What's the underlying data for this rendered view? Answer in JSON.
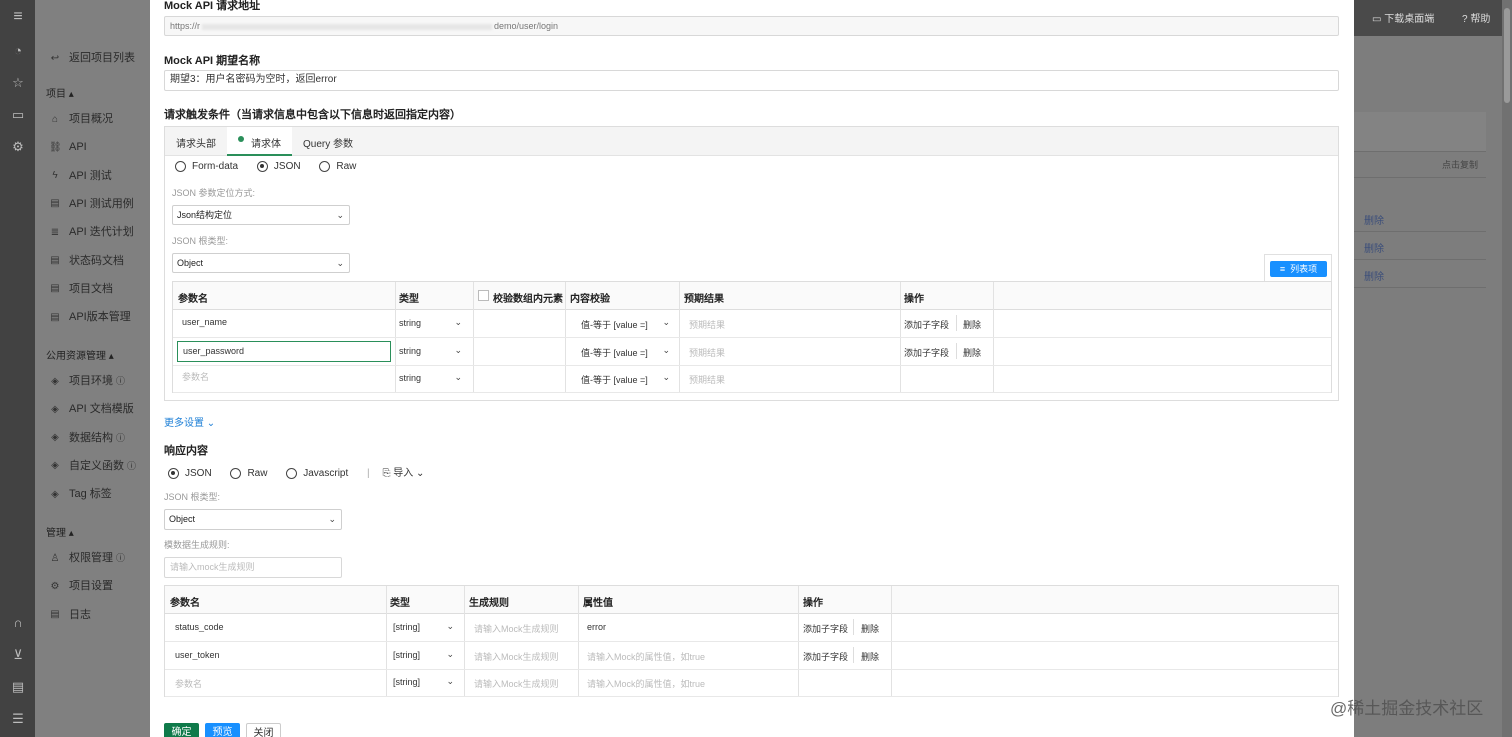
{
  "topbar": {
    "download": "下载桌面端",
    "help": "帮助"
  },
  "sidebar": {
    "back": "返回项目列表",
    "section_project": "项目 ▴",
    "items_project": [
      {
        "label": "项目概况",
        "icon": "house-icon"
      },
      {
        "label": "API",
        "icon": "link-icon"
      },
      {
        "label": "API 测试",
        "icon": "flash-icon"
      },
      {
        "label": "API 测试用例",
        "icon": "doc-icon"
      },
      {
        "label": "API 迭代计划",
        "icon": "list-icon"
      },
      {
        "label": "状态码文档",
        "icon": "doc-icon"
      },
      {
        "label": "项目文档",
        "icon": "doc-icon"
      },
      {
        "label": "API版本管理",
        "icon": "doc-icon"
      }
    ],
    "section_public": "公用资源管理 ▴",
    "items_public": [
      {
        "label": "项目环境",
        "icon": "cube-icon",
        "info": "ⓘ"
      },
      {
        "label": "API 文档模版",
        "icon": "cube-icon",
        "info": ""
      },
      {
        "label": "数据结构",
        "icon": "cube-icon",
        "info": "ⓘ"
      },
      {
        "label": "自定义函数",
        "icon": "cube-icon",
        "info": "ⓘ"
      },
      {
        "label": "Tag 标签",
        "icon": "cube-icon",
        "info": ""
      }
    ],
    "section_manage": "管理 ▴",
    "items_manage": [
      {
        "label": "权限管理",
        "icon": "user-icon",
        "info": "ⓘ"
      },
      {
        "label": "项目设置",
        "icon": "gear-icon",
        "info": ""
      },
      {
        "label": "日志",
        "icon": "doc-icon",
        "info": ""
      }
    ]
  },
  "background": {
    "copy": "点击复制",
    "delete": "删除"
  },
  "form": {
    "api_url_label": "Mock API 请求地址",
    "api_url_start": "https://r",
    "api_url_end": "demo/user/login",
    "name_label": "Mock API 期望名称",
    "name_value": "期望3：用户名密码为空时，返回error",
    "cond_label": "请求触发条件（当请求信息中包含以下信息时返回指定内容）",
    "tabs": [
      "请求头部",
      "请求体",
      "Query 参数"
    ],
    "body_types": [
      "Form-data",
      "JSON",
      "Raw"
    ],
    "json_locate_label": "JSON 参数定位方式:",
    "json_locate_value": "Json结构定位",
    "json_root_label": "JSON 根类型:",
    "json_root_value": "Object",
    "list_button": "列表项",
    "req_table": {
      "headers": {
        "name": "参数名",
        "type": "类型",
        "check_array": "校验数组内元素",
        "content": "内容校验",
        "expected": "预期结果",
        "ops": "操作"
      },
      "rows": [
        {
          "name": "user_name",
          "type": "string",
          "content": "值-等于 [value =]",
          "expected": "预期结果",
          "add": "添加子字段",
          "del": "删除"
        },
        {
          "name": "user_password",
          "type": "string",
          "content": "值-等于 [value =]",
          "expected": "预期结果",
          "add": "添加子字段",
          "del": "删除"
        },
        {
          "name": "参数名",
          "type": "string",
          "content": "值-等于 [value =]",
          "expected": "预期结果",
          "add": "",
          "del": ""
        }
      ]
    },
    "more_settings": "更多设置",
    "resp_label": "响应内容",
    "resp_types": [
      "JSON",
      "Raw",
      "Javascript"
    ],
    "import": "导入",
    "resp_root_label": "JSON 根类型:",
    "resp_root_value": "Object",
    "mock_rule_label": "模数据生成规则:",
    "mock_rule_placeholder": "请输入mock生成规则",
    "resp_table": {
      "headers": {
        "name": "参数名",
        "type": "类型",
        "rule": "生成规则",
        "value": "属性值",
        "ops": "操作"
      },
      "rows": [
        {
          "name": "status_code",
          "type": "[string]",
          "rule": "请输入Mock生成规则",
          "value": "error",
          "add": "添加子字段",
          "del": "删除"
        },
        {
          "name": "user_token",
          "type": "[string]",
          "rule": "请输入Mock生成规则",
          "value": "请输入Mock的属性值，如true",
          "add": "添加子字段",
          "del": "删除"
        },
        {
          "name": "参数名",
          "type": "[string]",
          "rule": "请输入Mock生成规则",
          "value": "请输入Mock的属性值，如true",
          "add": "",
          "del": ""
        }
      ]
    },
    "buttons": {
      "ok": "确定",
      "preview": "预览",
      "close": "关闭"
    }
  },
  "watermark": "@稀土掘金技术社区",
  "colors": {
    "primary": "#1890ff",
    "confirm": "#0f7a4a",
    "link": "#1e7fd6",
    "tab_dot": "#2a8f5a"
  }
}
